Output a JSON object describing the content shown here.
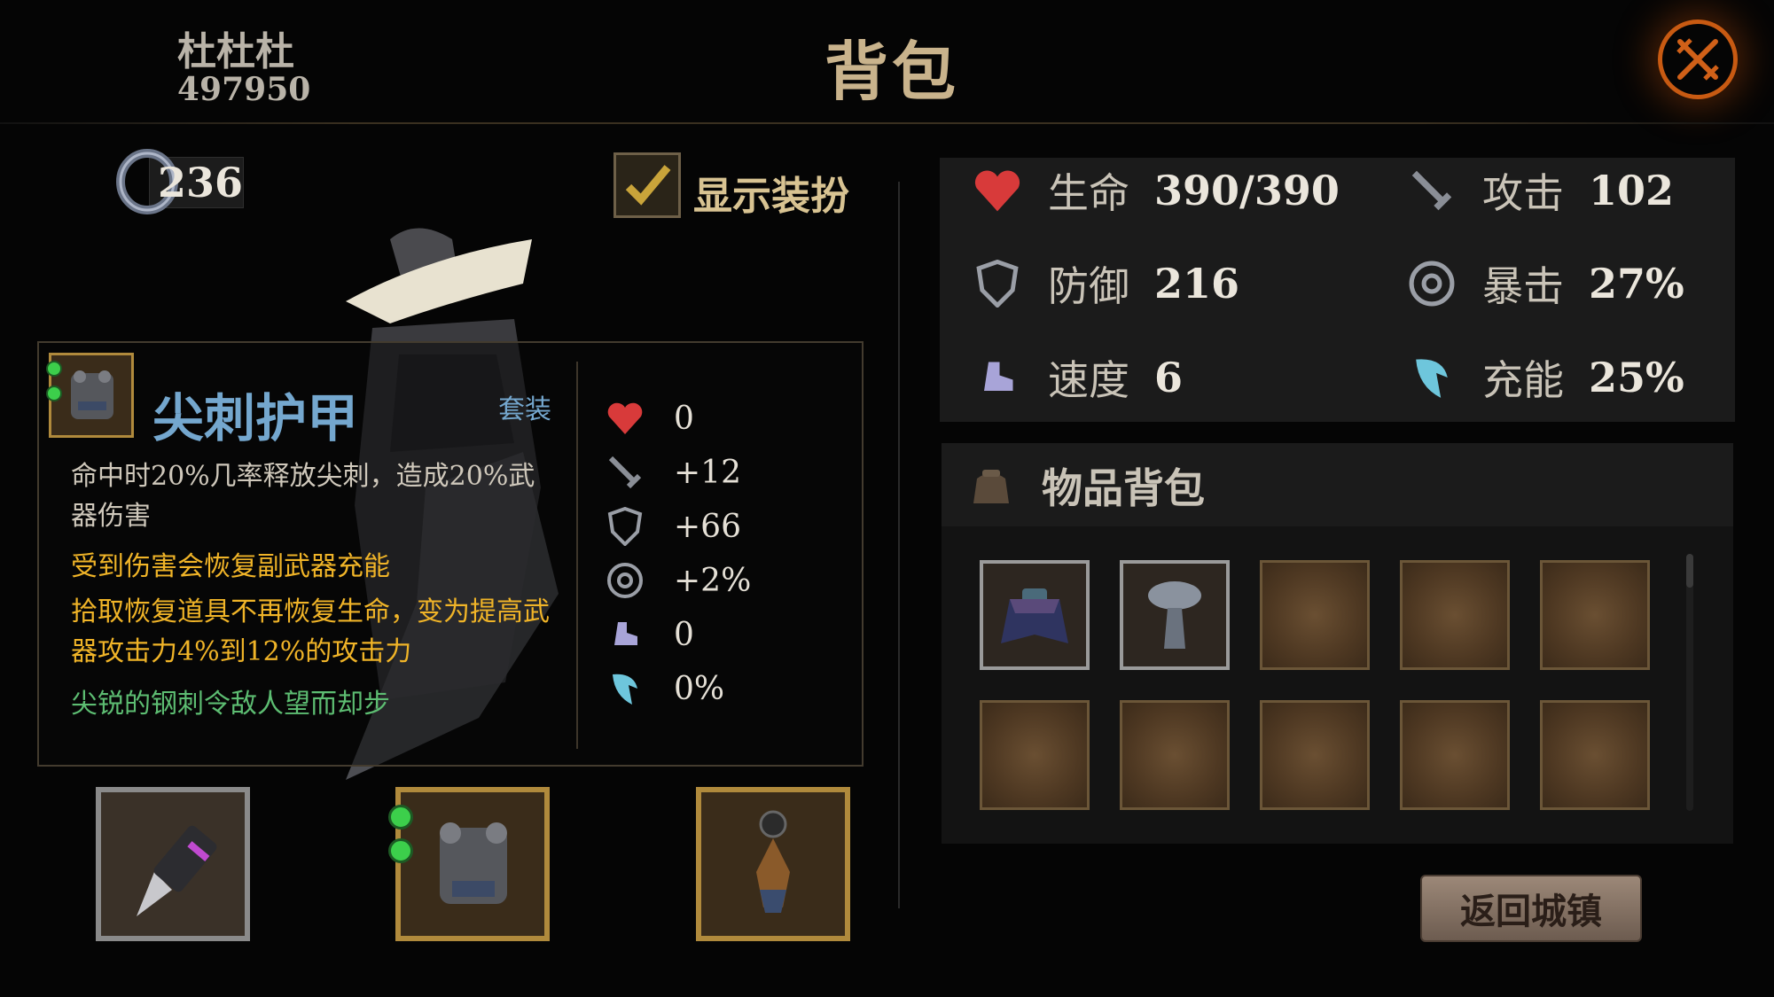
{
  "header": {
    "player_name": "杜杜杜",
    "player_id": "497950",
    "title": "背包",
    "close_icon": "crossed-swords-icon"
  },
  "currency": {
    "icon": "ring-icon",
    "value": "236"
  },
  "show_outfit": {
    "label": "显示装扮",
    "checked": true
  },
  "tooltip": {
    "item_name": "尖刺护甲",
    "set_tag": "套装",
    "description": "命中时20%几率释放尖刺，造成20%武器伤害",
    "effect_1": "受到伤害会恢复副武器充能",
    "effect_2": "拾取恢复道具不再恢复生命，变为提高武器攻击力4%到12%的攻击力",
    "flavor": "尖锐的钢刺令敌人望而却步",
    "bonuses": [
      {
        "icon": "heart-icon",
        "value": "0"
      },
      {
        "icon": "sword-icon",
        "value": "+12"
      },
      {
        "icon": "shield-icon",
        "value": "+66"
      },
      {
        "icon": "crit-icon",
        "value": "+2%"
      },
      {
        "icon": "boot-icon",
        "value": "0"
      },
      {
        "icon": "energy-icon",
        "value": "0%"
      }
    ]
  },
  "equipment": {
    "weapon": {
      "icon": "spear-weapon-icon"
    },
    "armor": {
      "icon": "spiked-armor-icon",
      "gems": 2
    },
    "accessory": {
      "icon": "amulet-icon"
    }
  },
  "stats": {
    "hp": {
      "label": "生命",
      "value": "390/390"
    },
    "attack": {
      "label": "攻击",
      "value": "102"
    },
    "defense": {
      "label": "防御",
      "value": "216"
    },
    "crit": {
      "label": "暴击",
      "value": "27%"
    },
    "speed": {
      "label": "速度",
      "value": "6"
    },
    "energy": {
      "label": "充能",
      "value": "25%"
    }
  },
  "inventory": {
    "title": "物品背包",
    "slots": [
      "cape-item-icon",
      "helmet-item-icon",
      "",
      "",
      "",
      "",
      "",
      "",
      "",
      ""
    ]
  },
  "return_button": "返回城镇",
  "colors": {
    "gold": "#c9b38c",
    "blue_name": "#74a7ce",
    "effect_orange": "#f0b428",
    "flavor_green": "#5dbd72",
    "accent_orange": "#c85a12"
  }
}
